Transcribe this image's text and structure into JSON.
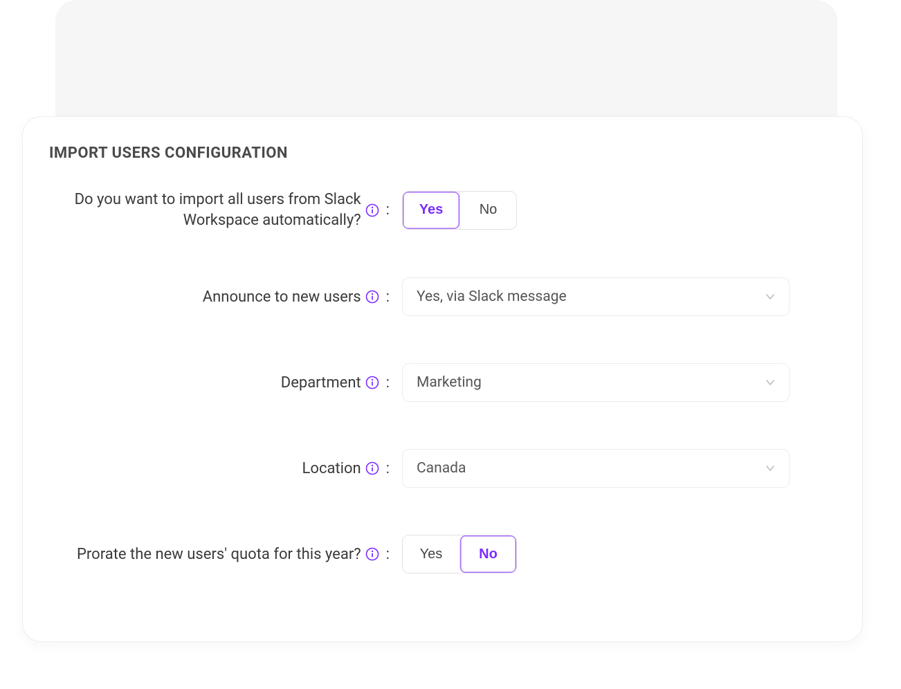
{
  "title": "IMPORT USERS CONFIGURATION",
  "colors": {
    "accent": "#7b2cff"
  },
  "import_auto": {
    "label": "Do you want to import all users from Slack Workspace automatically?",
    "yes": "Yes",
    "no": "No",
    "selected": "yes"
  },
  "announce": {
    "label": "Announce to new users",
    "value": "Yes, via Slack message"
  },
  "department": {
    "label": "Department",
    "value": "Marketing"
  },
  "location": {
    "label": "Location",
    "value": "Canada"
  },
  "prorate": {
    "label": "Prorate the new users' quota for this year?",
    "yes": "Yes",
    "no": "No",
    "selected": "no"
  }
}
